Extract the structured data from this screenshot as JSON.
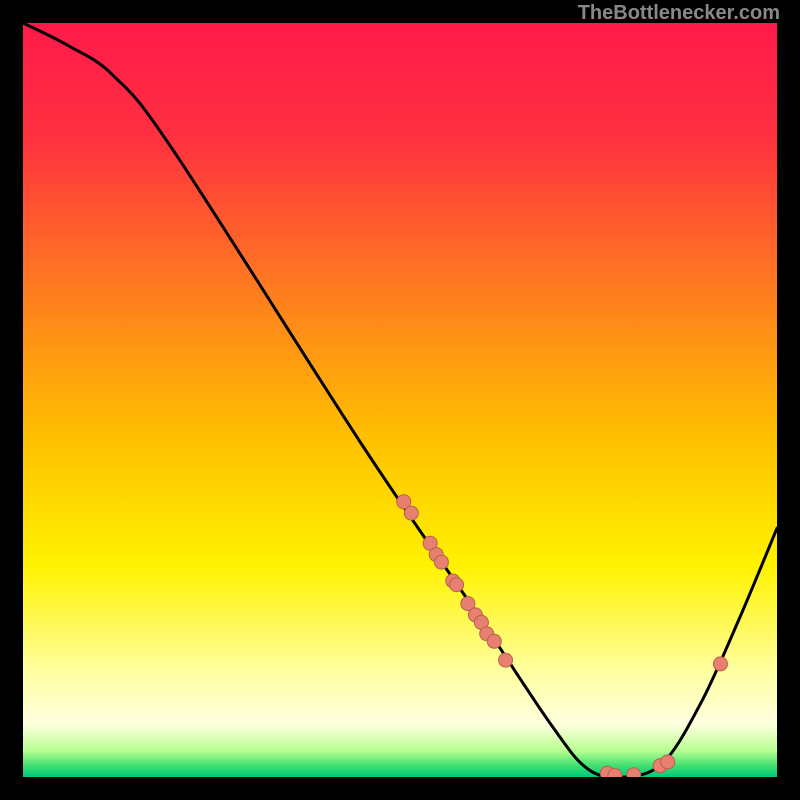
{
  "attribution": "TheBottlenecker.com",
  "chart_data": {
    "type": "line",
    "title": "",
    "xlabel": "",
    "ylabel": "",
    "xlim": [
      0,
      100
    ],
    "ylim": [
      0,
      100
    ],
    "curve": [
      {
        "x": 0,
        "y": 100
      },
      {
        "x": 6,
        "y": 97
      },
      {
        "x": 12,
        "y": 93
      },
      {
        "x": 20,
        "y": 83
      },
      {
        "x": 45,
        "y": 44
      },
      {
        "x": 60,
        "y": 22
      },
      {
        "x": 70,
        "y": 7
      },
      {
        "x": 75,
        "y": 1
      },
      {
        "x": 80,
        "y": 0
      },
      {
        "x": 85,
        "y": 2
      },
      {
        "x": 90,
        "y": 10
      },
      {
        "x": 95,
        "y": 21
      },
      {
        "x": 100,
        "y": 33
      }
    ],
    "scatter_points": [
      {
        "x": 50.5,
        "y": 36.5
      },
      {
        "x": 51.5,
        "y": 35.0
      },
      {
        "x": 54.0,
        "y": 31.0
      },
      {
        "x": 54.8,
        "y": 29.5
      },
      {
        "x": 55.5,
        "y": 28.5
      },
      {
        "x": 57.0,
        "y": 26.0
      },
      {
        "x": 57.5,
        "y": 25.5
      },
      {
        "x": 59.0,
        "y": 23.0
      },
      {
        "x": 60.0,
        "y": 21.5
      },
      {
        "x": 60.8,
        "y": 20.5
      },
      {
        "x": 61.5,
        "y": 19.0
      },
      {
        "x": 62.5,
        "y": 18.0
      },
      {
        "x": 64.0,
        "y": 15.5
      },
      {
        "x": 77.5,
        "y": 0.5
      },
      {
        "x": 78.5,
        "y": 0.2
      },
      {
        "x": 81.0,
        "y": 0.3
      },
      {
        "x": 84.5,
        "y": 1.5
      },
      {
        "x": 85.5,
        "y": 2.0
      },
      {
        "x": 92.5,
        "y": 15.0
      }
    ],
    "gradient_stops": [
      {
        "pos": 0.0,
        "color": "#ff1a4a"
      },
      {
        "pos": 0.15,
        "color": "#ff3040"
      },
      {
        "pos": 0.35,
        "color": "#ff7a20"
      },
      {
        "pos": 0.55,
        "color": "#ffc000"
      },
      {
        "pos": 0.72,
        "color": "#fff200"
      },
      {
        "pos": 0.86,
        "color": "#ffffa0"
      },
      {
        "pos": 0.93,
        "color": "#ffffe0"
      },
      {
        "pos": 0.965,
        "color": "#b8ff90"
      },
      {
        "pos": 0.985,
        "color": "#40e070"
      },
      {
        "pos": 1.0,
        "color": "#00c878"
      }
    ],
    "point_fill": "#e88070",
    "point_stroke": "#b86050",
    "curve_stroke": "#000000"
  }
}
